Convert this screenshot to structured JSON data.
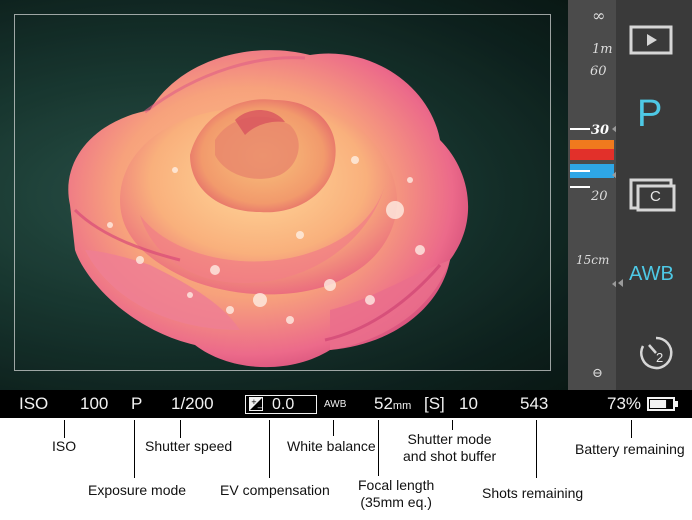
{
  "status_bar": {
    "iso_label": "ISO",
    "iso_value": "100",
    "exposure_mode": "P",
    "shutter_speed": "1/200",
    "ev_value": "0.0",
    "white_balance": "AWB",
    "focal_length_value": "52",
    "focal_length_unit": "mm",
    "shutter_mode": "[S]",
    "shot_buffer": "10",
    "shots_remaining": "543",
    "battery_percent": "73%",
    "battery_level": 0.73
  },
  "focus_scale": {
    "infinity": "∞",
    "one_m": "1m",
    "sixty": "60",
    "thirty": "30",
    "twenty": "20",
    "fifteen_cm": "15cm",
    "bottom_symbol": "⊖"
  },
  "mode_panel": {
    "playback_icon": "play-icon",
    "exposure_mode": "P",
    "drive_mode_letter": "C",
    "white_balance": "AWB",
    "self_timer_seconds": "2"
  },
  "callouts": {
    "iso": "ISO",
    "exposure_mode": "Exposure mode",
    "shutter_speed": "Shutter speed",
    "ev_compensation": "EV compensation",
    "white_balance": "White balance",
    "focal_length_1": "Focal length",
    "focal_length_2": "(35mm eq.)",
    "shutter_mode_1": "Shutter mode",
    "shutter_mode_2": "and shot buffer",
    "shots_remaining": "Shots remaining",
    "battery_remaining": "Battery remaining"
  },
  "colors": {
    "accent_cyan": "#4ec9e6",
    "exposure_orange": "#f07a1e",
    "exposure_red": "#e2302a",
    "exposure_blue": "#2ea6e6",
    "status_bar_bg": "#000000"
  }
}
